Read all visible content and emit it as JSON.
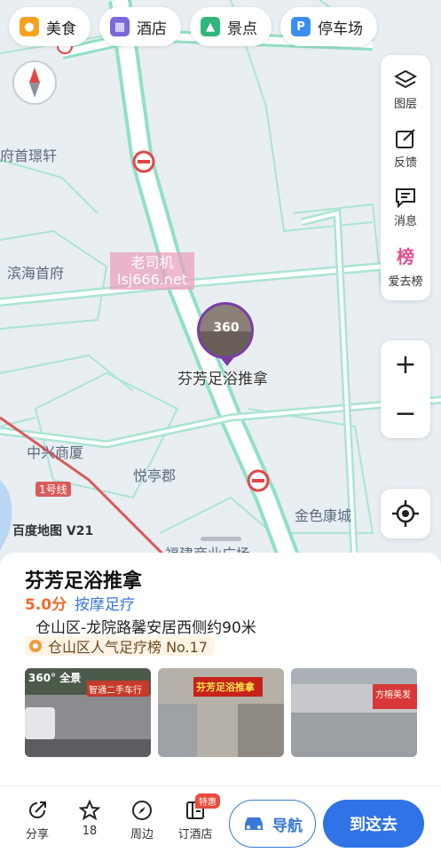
{
  "categories": [
    {
      "label": "美食",
      "icon": "food-icon",
      "color": "#f7a21b"
    },
    {
      "label": "酒店",
      "icon": "hotel-icon",
      "color": "#7a68d8"
    },
    {
      "label": "景点",
      "icon": "scenic-icon",
      "color": "#2fb77a"
    },
    {
      "label": "停车场",
      "icon": "parking-icon",
      "color": "#3a8ef0"
    }
  ],
  "tools": {
    "layers": "图层",
    "feedback": "反馈",
    "messages": "消息",
    "love_list": "爱去榜",
    "love_list_badge": "榜"
  },
  "zoom": {
    "in": "+",
    "out": "−"
  },
  "map_labels": {
    "l1": "府首璟轩",
    "l2": "滨海首府",
    "l3": "中兴商厦",
    "l4": "悦亭郡",
    "l5": "金色康城",
    "l6": "1号线",
    "l7": "福建商业广场"
  },
  "watermark": {
    "line1": "老司机",
    "line2": "lsj666.net"
  },
  "poi_marker": {
    "badge": "360",
    "name": "芬芳足浴推拿"
  },
  "scale": "百度地图 V21",
  "place": {
    "name": "芬芳足浴推拿",
    "rating": "5.0分",
    "category": "按摩足疗",
    "address": "仓山区-龙院路馨安居西侧约90米",
    "rank": "仓山区人气足疗榜 No.17"
  },
  "photos": [
    {
      "label": "360° 全景",
      "sign": "智通二手车行"
    },
    {
      "label": "",
      "sign": "芬芳足浴推拿"
    },
    {
      "label": "",
      "sign": "方榕美发"
    }
  ],
  "bottom": {
    "share": "分享",
    "favorite_count": "18",
    "nearby": "周边",
    "hotel": "订酒店",
    "hotel_tag": "特惠",
    "navigate": "导航",
    "go_here": "到这去"
  }
}
